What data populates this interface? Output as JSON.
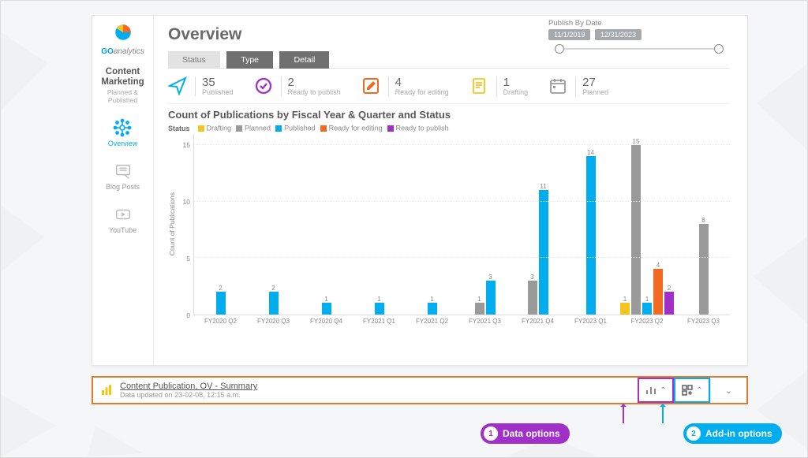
{
  "brand": {
    "go": "GO",
    "rest": "analytics"
  },
  "sidebar": {
    "heading": "Content Marketing",
    "subheading": "Planned & Published",
    "items": [
      {
        "label": "Overview",
        "active": true
      },
      {
        "label": "Blog Posts",
        "active": false
      },
      {
        "label": "YouTube",
        "active": false
      }
    ]
  },
  "header": {
    "title": "Overview",
    "date_filter": {
      "label": "Publish By Date",
      "from": "11/1/2019",
      "to": "12/31/2023"
    },
    "tabs": [
      {
        "label": "Status",
        "active": true
      },
      {
        "label": "Type",
        "active": false
      },
      {
        "label": "Detail",
        "active": false
      }
    ]
  },
  "kpis": [
    {
      "value": "35",
      "label": "Published",
      "color": "#00aeef",
      "icon": "paper-plane"
    },
    {
      "value": "2",
      "label": "Ready to publish",
      "color": "#a030c8",
      "icon": "check-circle"
    },
    {
      "value": "4",
      "label": "Ready for editing",
      "color": "#f26a21",
      "icon": "pencil-square"
    },
    {
      "value": "1",
      "label": "Drafting",
      "color": "#f4c521",
      "icon": "document"
    },
    {
      "value": "27",
      "label": "Planned",
      "color": "#9a9a9a",
      "icon": "calendar"
    }
  ],
  "chart_title": "Count of Publications by Fiscal Year & Quarter and Status",
  "legend_header": "Status",
  "legend": [
    {
      "name": "Drafting",
      "color": "#f4c521"
    },
    {
      "name": "Planned",
      "color": "#9a9a9a"
    },
    {
      "name": "Published",
      "color": "#00aeef"
    },
    {
      "name": "Ready for editing",
      "color": "#f26a21"
    },
    {
      "name": "Ready to publish",
      "color": "#a030c8"
    }
  ],
  "chart_data": {
    "type": "bar",
    "title": "Count of Publications by Fiscal Year & Quarter and Status",
    "xlabel": "",
    "ylabel": "Count of Publications",
    "ylim": [
      0,
      16
    ],
    "yticks": [
      0,
      5,
      10,
      15
    ],
    "categories": [
      "FY2020 Q2",
      "FY2020 Q3",
      "FY2020 Q4",
      "FY2021 Q1",
      "FY2021 Q2",
      "FY2021 Q3",
      "FY2021 Q4",
      "FY2023 Q1",
      "FY2023 Q2",
      "FY2023 Q3"
    ],
    "series": [
      {
        "name": "Drafting",
        "color": "#f4c521",
        "values": [
          0,
          0,
          0,
          0,
          0,
          0,
          0,
          0,
          1,
          0
        ]
      },
      {
        "name": "Planned",
        "color": "#9a9a9a",
        "values": [
          0,
          0,
          0,
          0,
          0,
          1,
          3,
          0,
          15,
          8
        ]
      },
      {
        "name": "Published",
        "color": "#00aeef",
        "values": [
          2,
          2,
          1,
          1,
          1,
          3,
          11,
          14,
          1,
          0
        ]
      },
      {
        "name": "Ready for editing",
        "color": "#f26a21",
        "values": [
          0,
          0,
          0,
          0,
          0,
          0,
          0,
          0,
          4,
          0
        ]
      },
      {
        "name": "Ready to publish",
        "color": "#a030c8",
        "values": [
          0,
          0,
          0,
          0,
          0,
          0,
          0,
          0,
          2,
          0
        ]
      }
    ]
  },
  "bottom_bar": {
    "title": "Content Publication, OV - Summary",
    "subtitle": "Data updated on 23-02-08, 12:15 a.m."
  },
  "callouts": {
    "data_options_num": "1",
    "data_options_label": "Data options",
    "addin_options_num": "2",
    "addin_options_label": "Add-in options"
  }
}
